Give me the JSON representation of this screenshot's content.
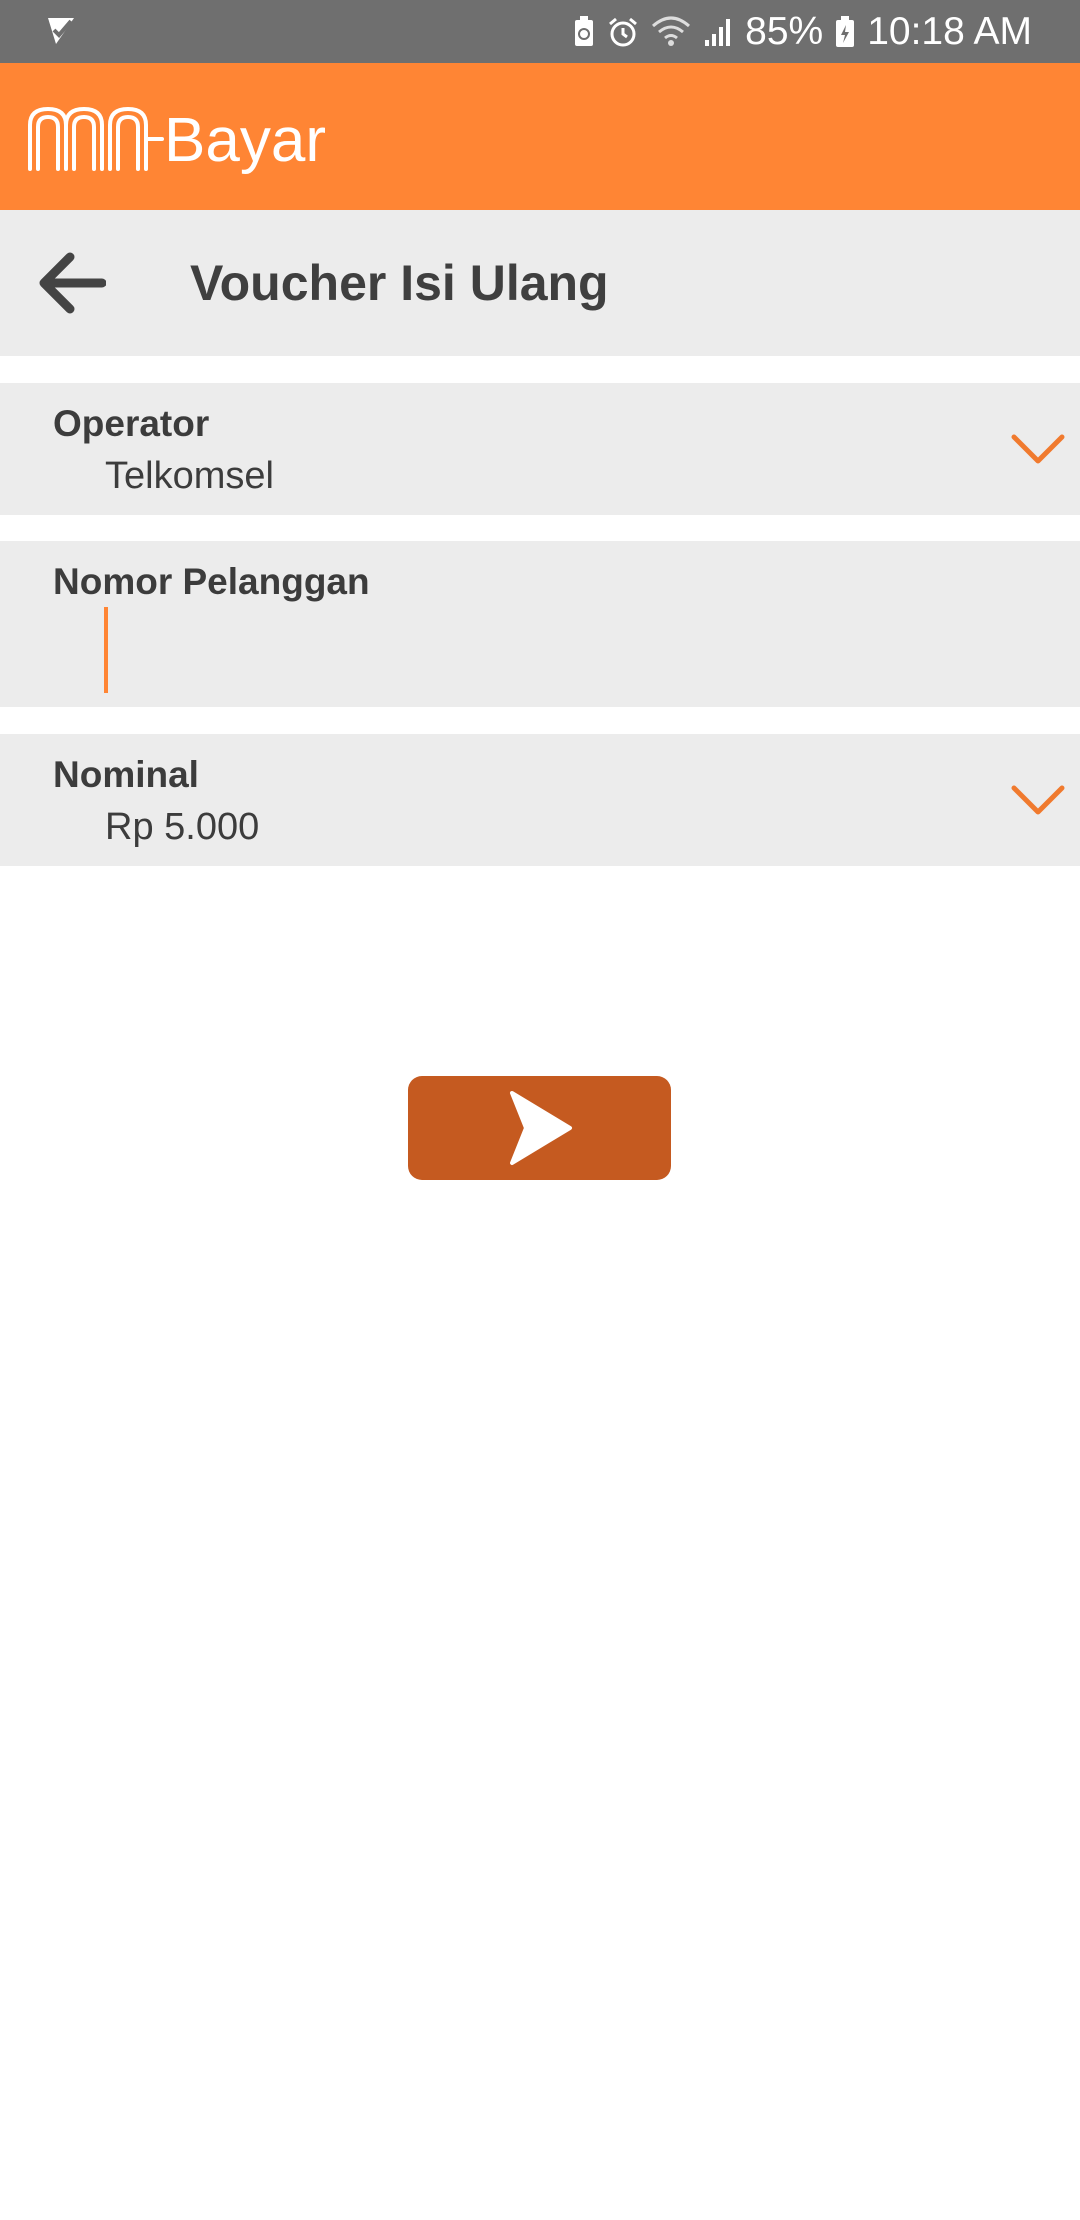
{
  "status_bar": {
    "battery": "85%",
    "time": "10:18 AM",
    "icons": [
      "notification-icon",
      "battery-saver-icon",
      "alarm-icon",
      "wifi-icon",
      "signal-icon",
      "battery-charging-icon"
    ]
  },
  "app": {
    "logo_text": "m-Bayar",
    "brand_color": "#ff8534"
  },
  "toolbar": {
    "title": "Voucher Isi Ulang",
    "back_icon": "arrow-left-icon"
  },
  "form": {
    "operator": {
      "label": "Operator",
      "value": "Telkomsel"
    },
    "customer_number": {
      "label": "Nomor Pelanggan",
      "value": "",
      "placeholder": ""
    },
    "nominal": {
      "label": "Nominal",
      "value": "Rp 5.000"
    }
  },
  "next_button": {
    "icon": "chevron-right-icon",
    "color": "#c55a20"
  }
}
